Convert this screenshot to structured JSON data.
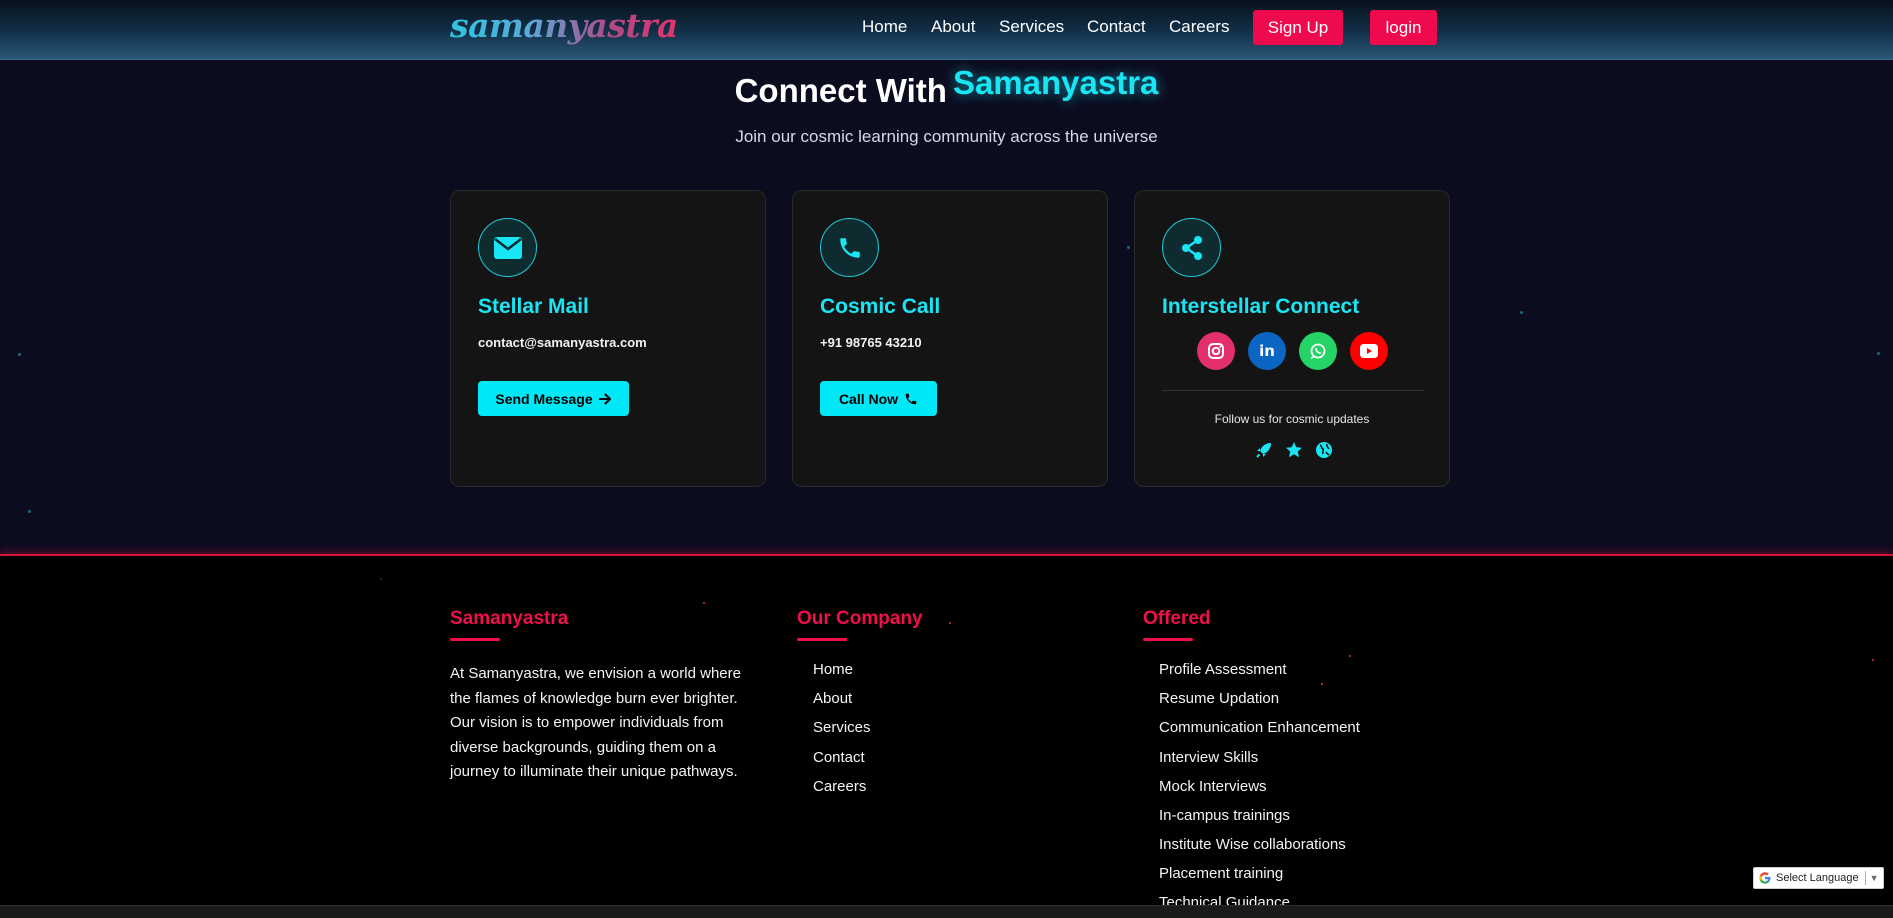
{
  "header": {
    "logo": "samanyastra",
    "nav": [
      "Home",
      "About",
      "Services",
      "Contact",
      "Careers"
    ],
    "signup_label": "Sign Up",
    "login_label": "login"
  },
  "connect": {
    "title_plain": "Connect With",
    "title_accent": "Samanyastra",
    "subtitle": "Join our cosmic learning community across the universe",
    "cards": [
      {
        "icon": "envelope-icon",
        "title": "Stellar Mail",
        "text": "contact@samanyastra.com",
        "button": "Send Message",
        "button_icon": "arrow-right-icon"
      },
      {
        "icon": "phone-icon",
        "title": "Cosmic Call",
        "text": "+91 98765 43210",
        "button": "Call Now",
        "button_icon": "phone-icon"
      },
      {
        "icon": "share-icon",
        "title": "Interstellar Connect",
        "socials": [
          {
            "name": "instagram-icon",
            "color": "#e1306c"
          },
          {
            "name": "linkedin-icon",
            "color": "#0a66c2"
          },
          {
            "name": "whatsapp-icon",
            "color": "#25d366"
          },
          {
            "name": "youtube-icon",
            "color": "#ff0000"
          }
        ],
        "follow_text": "Follow us for cosmic updates",
        "mini_icons": [
          "rocket-icon",
          "star-icon",
          "globe-icon"
        ]
      }
    ]
  },
  "footer": {
    "columns": [
      {
        "heading": "Samanyastra",
        "text": "At Samanyastra, we envision a world where the flames of knowledge burn ever brighter. Our vision is to empower individuals from diverse backgrounds, guiding them on a journey to illuminate their unique pathways."
      },
      {
        "heading": "Our Company",
        "links": [
          "Home",
          "About",
          "Services",
          "Contact",
          "Careers"
        ]
      },
      {
        "heading": "Offered",
        "links": [
          "Profile Assessment",
          "Resume Updation",
          "Communication Enhancement",
          "Interview Skills",
          "Mock Interviews",
          "In-campus trainings",
          "Institute Wise collaborations",
          "Placement training",
          "Technical Guidance"
        ]
      }
    ]
  },
  "language": {
    "label": "Select Language"
  },
  "colors": {
    "accent_cyan": "#19e6f5",
    "accent_pink": "#ef0f4a",
    "button_pink": "#ee0a4d"
  }
}
